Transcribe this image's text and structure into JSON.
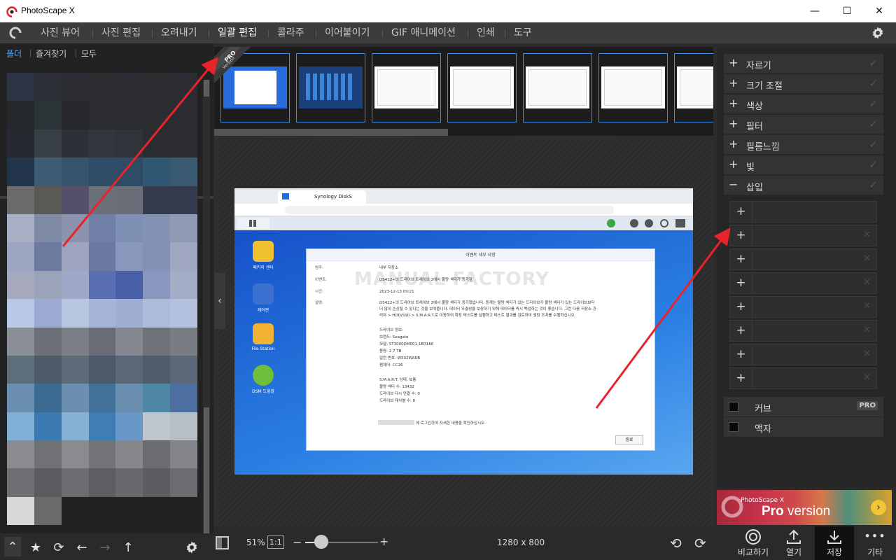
{
  "window": {
    "title": "PhotoScape X",
    "minimize_icon": "—",
    "maximize_icon": "☐",
    "close_icon": "✕"
  },
  "menu": {
    "tabs": [
      "사진 뷰어",
      "사진 편집",
      "오려내기",
      "일괄 편집",
      "콜라주",
      "이어붙이기",
      "GIF 애니메이션",
      "인쇄",
      "도구"
    ],
    "active_index": 3
  },
  "left_panel": {
    "tabs": [
      "폴더",
      "즐겨찾기",
      "모두"
    ],
    "active_tab": 0,
    "mosaic_colors": [
      "#2a3442",
      "#2c2f35",
      "#2a2c31",
      "#2c2d31",
      "#2c2e33",
      "#2c2d31",
      "#2a2c31",
      "#25282d",
      "#2a3336",
      "#26282c",
      "#2b2c30",
      "#2a2c2f",
      "#2c2d31",
      "#2a2c31",
      "#252a31",
      "#393f47",
      "#2c3038",
      "#33363c",
      "#30343a",
      "#2a2c31",
      "#2a2c31",
      "#23354a",
      "#3d5c73",
      "#36546c",
      "#2e4c66",
      "#2e4c66",
      "#305872",
      "#3a5a72",
      "#6b6b6b",
      "#5a5a55",
      "#554f6a",
      "#6b6f7a",
      "#6a6e79",
      "#353b4d",
      "#353b4d",
      "#a8aec4",
      "#7e8aa6",
      "#8b93ad",
      "#6f7fa6",
      "#7e8fb4",
      "#8391b2",
      "#909ab4",
      "#9ba5c2",
      "#6c7b9f",
      "#9da4bf",
      "#6d79a3",
      "#8a97bd",
      "#8591b3",
      "#9fa8c0",
      "#a6a8bd",
      "#9aa3b8",
      "#9da9c7",
      "#5a6fb2",
      "#495fa8",
      "#8996bd",
      "#a3aec6",
      "#b9c8e4",
      "#9ba9d3",
      "#b8c6e2",
      "#a5b3d7",
      "#9fafd3",
      "#aebbd9",
      "#b5c2df",
      "#8b8f98",
      "#6d7079",
      "#7b7e86",
      "#696c75",
      "#858890",
      "#6e7178",
      "#7a7c83",
      "#5e6e7a",
      "#4d5a68",
      "#5d6a78",
      "#4c5968",
      "#5a6776",
      "#4e5c6b",
      "#5b6877",
      "#6b8fb0",
      "#3b6a92",
      "#6c8fb0",
      "#42719a",
      "#6a8eaf",
      "#4e87a4",
      "#4d6ea0",
      "#7fb1d7",
      "#3a7ab0",
      "#86b1d6",
      "#3f7eb2",
      "#6a97c9",
      "#c0c6cd",
      "#b8bec5",
      "#8a8c8f",
      "#6f7175",
      "#898b8f",
      "#727478",
      "#86888c",
      "#6a6c70",
      "#838589",
      "#6d6f73",
      "#5a5c60",
      "#6a6c70",
      "#5c5e62",
      "#68696d",
      "#5b5d61",
      "#6a6c70",
      "#d7d7d7",
      "#6a6a6a"
    ]
  },
  "strip": {
    "count": 7
  },
  "pro_ribbon": {
    "label_pro": "PRO",
    "label_version": "Version"
  },
  "screenshot": {
    "tab_title": "Synology DiskS",
    "desktop_icons": [
      {
        "label": "패키지 센터",
        "color": "#f0c030"
      },
      {
        "label": "제어판",
        "color": "#3b6fd0"
      },
      {
        "label": "File Station",
        "color": "#f2b233"
      },
      {
        "label": "DSM 도움말",
        "color": "#6fbf3b"
      }
    ],
    "dialog": {
      "title": "이벤트 세부 사항",
      "watermark": "MANUAL FACTORY",
      "rows": [
        {
          "k": "범주:",
          "v": "내부 저장소"
        },
        {
          "k": "이벤트:",
          "v": "DS412+의 드라이브 트레이브 2에서 불량 섹터가 증가함"
        },
        {
          "k": "시간:",
          "v": "2023-12-13 09:21"
        },
        {
          "k": "설명:",
          "v": "DS412+의 드라이브 트레이브 2에서 불량 섹터가 증가했습니다. 동계는 불량 섹터가 있는 드라이브가 불량 섹터가 있는 드라이브보다"
        }
      ],
      "desc2": "더 많이 손상될 수 있다는 것을 보여줍니다. 데이터 무결성을 보장하기 위해 데이터를 즉시 백업하는 것이 좋습니다. 그런 다음 저장소 관",
      "desc3": "리자 > HDD/SSD > S.M.A.R.T.로 이동하여 확장 테스트를 실행하고 테스트 결과를 검토하여 권장 조치를 수행하십시오.",
      "drive_info": [
        "드라이브 정보:",
        "브랜드: Seagate",
        "모델: ST3000DM001-1ER166",
        "용량: 2.7 TB",
        "일련 번호: W502WARB",
        "펌웨어: CC26"
      ],
      "smart_info": [
        "S.M.A.R.T. 상태: 보통",
        "불량 섹터 수: 13432",
        "드라이브 다시 연결 수: 0",
        "드라이브 재식별 수: 0"
      ],
      "footer": "에 로그인하여 자세한 내용을 확인하십시오.",
      "ok": "종료"
    }
  },
  "right_panel": {
    "effects": [
      "자르기",
      "크기 조절",
      "색상",
      "필터",
      "필름느낌",
      "빛"
    ],
    "insert": {
      "label": "삽입",
      "expanded_icon": "−"
    },
    "slots": 8,
    "checkboxes": [
      {
        "label": "커브",
        "pro": "PRO"
      },
      {
        "label": "액자",
        "pro": ""
      }
    ]
  },
  "pro_banner": {
    "small": "PhotoScape X",
    "pro": "Pro",
    "version": "version"
  },
  "bottom": {
    "zoom": "51%",
    "actual_size": "1:1",
    "dimensions": "1280 x 800",
    "zoom_level": 0.22,
    "buttons": [
      "비교하기",
      "열기",
      "저장",
      "기타"
    ],
    "active_button": 2
  }
}
